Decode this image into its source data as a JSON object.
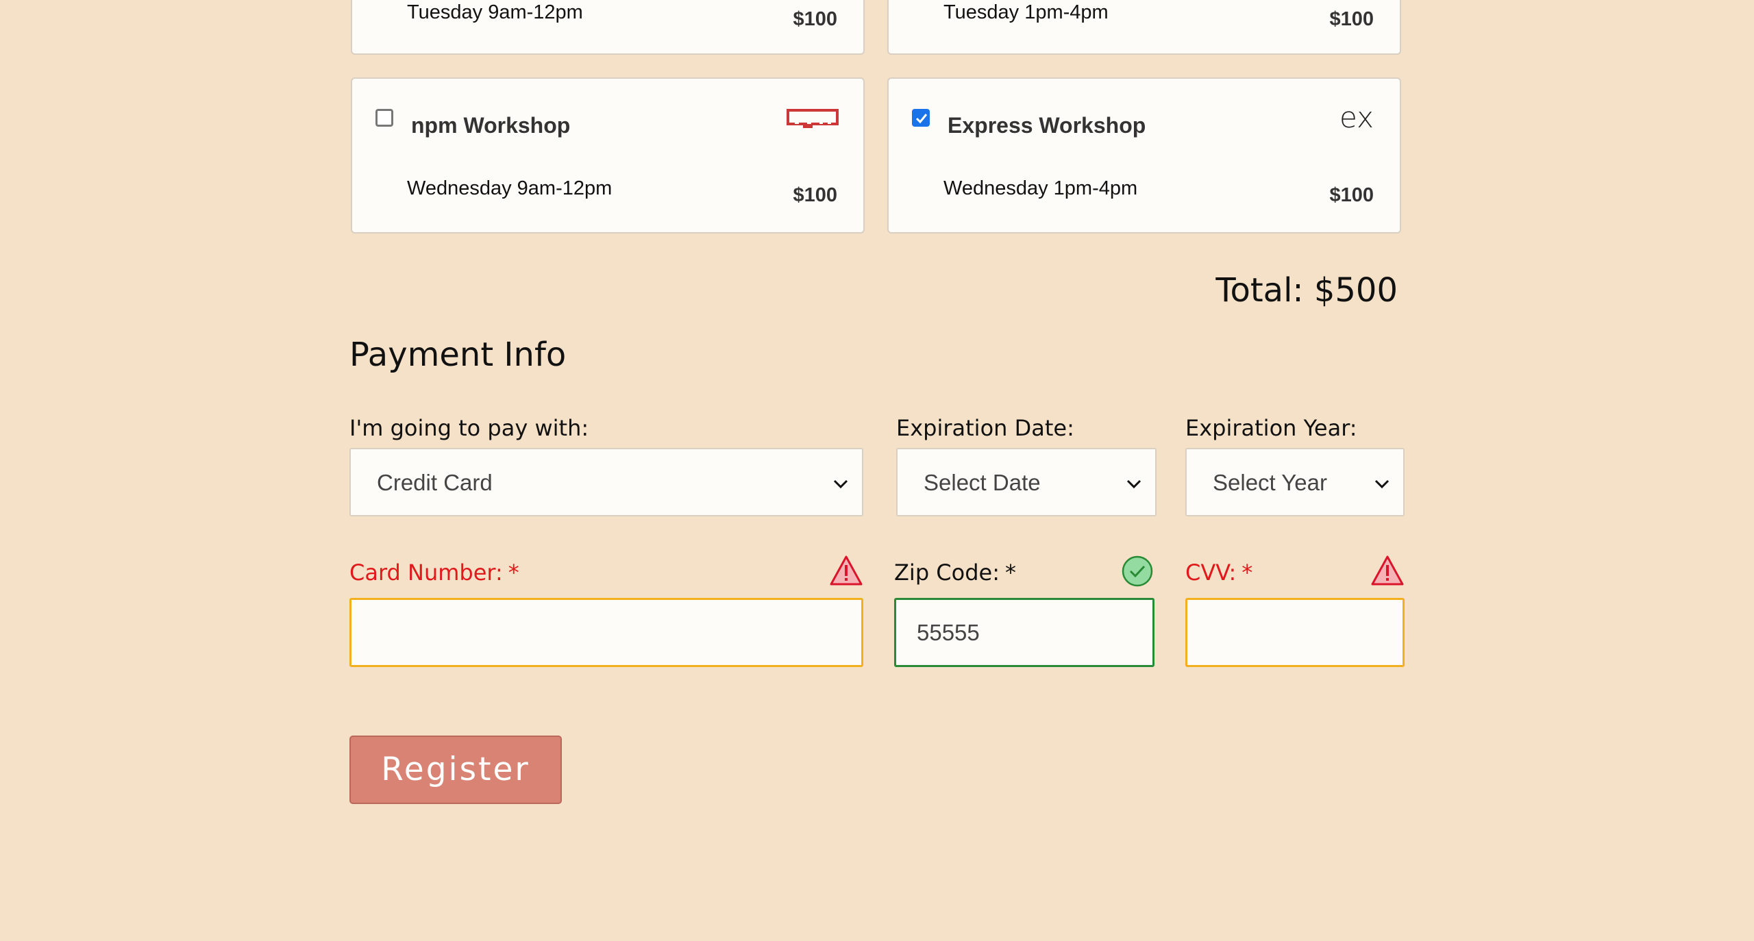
{
  "workshops": [
    {
      "title": "",
      "time": "Tuesday 9am-12pm",
      "price": "$100"
    },
    {
      "title": "",
      "time": "Tuesday 1pm-4pm",
      "price": "$100"
    },
    {
      "title": "npm Workshop",
      "time": "Wednesday 9am-12pm",
      "price": "$100",
      "checked": false,
      "logo": "npm-logo"
    },
    {
      "title": "Express Workshop",
      "time": "Wednesday 1pm-4pm",
      "price": "$100",
      "checked": true,
      "logo": "express-logo",
      "logo_text": "ex"
    }
  ],
  "total": "Total: $500",
  "payment": {
    "title": "Payment Info",
    "pay_with_label": "I'm going to pay with:",
    "pay_with_value": "Credit Card",
    "exp_date_label": "Expiration Date:",
    "exp_date_value": "Select Date",
    "exp_year_label": "Expiration Year:",
    "exp_year_value": "Select Year",
    "card_number_label": "Card Number:",
    "card_number_value": "",
    "zip_label": "Zip Code:",
    "zip_value": "55555",
    "cvv_label": "CVV:",
    "cvv_value": "",
    "required_mark": "*"
  },
  "register_label": "Register",
  "colors": {
    "background": "#f5e1c8",
    "error": "#e0191b",
    "valid": "#2a8a35",
    "warning_border": "#f2b01e",
    "checkbox_checked": "#1a73e8",
    "register_button": "#d98375"
  }
}
